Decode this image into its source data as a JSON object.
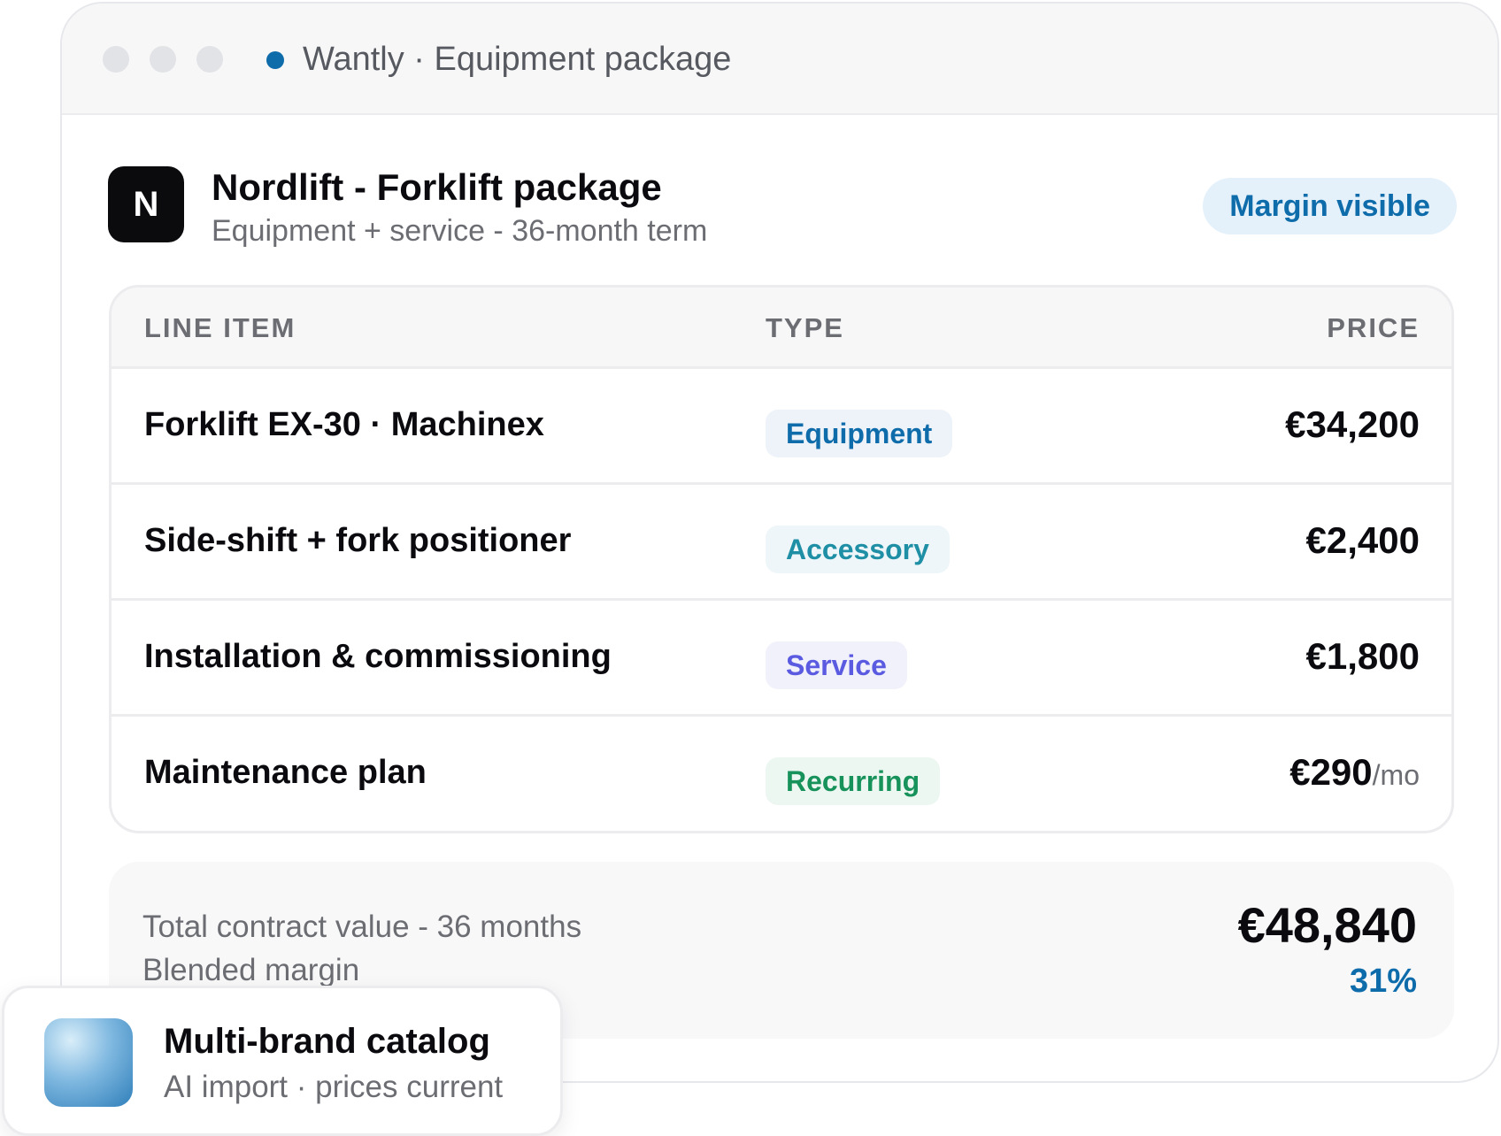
{
  "window": {
    "title": "Wantly · Equipment package"
  },
  "package": {
    "logo_letter": "N",
    "title": "Nordlift - Forklift package",
    "subtitle": "Equipment + service - 36-month term",
    "margin_badge": "Margin visible"
  },
  "table": {
    "headers": {
      "item": "LINE ITEM",
      "type": "TYPE",
      "price": "PRICE"
    },
    "rows": [
      {
        "name": "Forklift EX-30 · Machinex",
        "type": "Equipment",
        "price": "€34,200",
        "unit": ""
      },
      {
        "name": "Side-shift + fork positioner",
        "type": "Accessory",
        "price": "€2,400",
        "unit": ""
      },
      {
        "name": "Installation & commissioning",
        "type": "Service",
        "price": "€1,800",
        "unit": ""
      },
      {
        "name": "Maintenance plan",
        "type": "Recurring",
        "price": "€290",
        "unit": "/mo"
      }
    ]
  },
  "type_colors": {
    "Equipment": {
      "text": "#0f6cab",
      "bg": "#edf3f8"
    },
    "Accessory": {
      "text": "#1f8fa6",
      "bg": "#eef6f9"
    },
    "Service": {
      "text": "#5a5be0",
      "bg": "#f1f1fc"
    },
    "Recurring": {
      "text": "#16925a",
      "bg": "#edf7f1"
    }
  },
  "summary": {
    "label_total": "Total contract value - 36 months",
    "label_margin": "Blended margin",
    "total": "€48,840",
    "margin": "31%"
  },
  "catalog": {
    "title": "Multi-brand catalog",
    "subtitle": "AI import · prices current"
  },
  "colors": {
    "accent": "#0f6cab",
    "text_primary": "#0b0b0f",
    "text_muted": "#6b6d73"
  }
}
